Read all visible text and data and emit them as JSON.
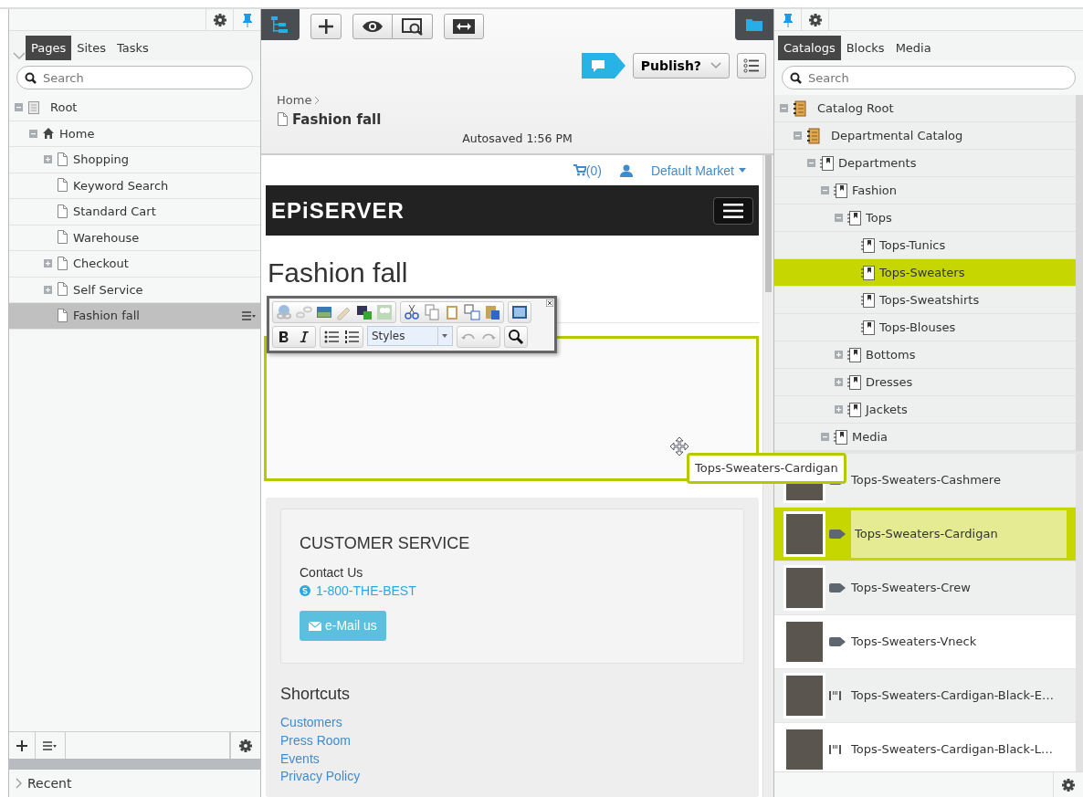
{
  "left_panel": {
    "tabs": [
      {
        "label": "Pages",
        "selected": true
      },
      {
        "label": "Sites",
        "selected": false
      },
      {
        "label": "Tasks",
        "selected": false
      }
    ],
    "search": {
      "placeholder": "Search"
    },
    "tree": [
      {
        "label": "Root",
        "kind": "root",
        "expanded": true,
        "selected": false,
        "children": [
          {
            "label": "Home",
            "kind": "home",
            "expanded": true,
            "selected": false,
            "children": [
              {
                "label": "Shopping",
                "kind": "page",
                "expanded": false,
                "selected": false
              },
              {
                "label": "Keyword Search",
                "kind": "page",
                "selected": false
              },
              {
                "label": "Standard Cart",
                "kind": "page",
                "selected": false
              },
              {
                "label": "Warehouse",
                "kind": "page",
                "selected": false
              },
              {
                "label": "Checkout",
                "kind": "page",
                "expanded": false,
                "selected": false
              },
              {
                "label": "Self Service",
                "kind": "page",
                "expanded": false,
                "selected": false
              },
              {
                "label": "Fashion fall",
                "kind": "page",
                "selected": true
              }
            ]
          }
        ]
      }
    ],
    "recent": "Recent"
  },
  "editor": {
    "breadcrumb": "Home",
    "page_title": "Fashion fall",
    "autosaved": "Autosaved 1:56 PM",
    "publish_button": "Publish?",
    "preview": {
      "cart_count": "(0)",
      "market": "Default Market",
      "logo": "EPiSERVER",
      "heading": "Fashion fall",
      "styles_dropdown": "Styles",
      "drag_tooltip": "Tops-Sweaters-Cardigan",
      "customer_service": {
        "title": "CUSTOMER SERVICE",
        "contact": "Contact Us",
        "phone": "1-800-THE-BEST",
        "email_button": "e-Mail us"
      },
      "shortcuts": {
        "title": "Shortcuts",
        "links": [
          "Customers",
          "Press Room",
          "Events",
          "Privacy Policy"
        ]
      }
    }
  },
  "right_panel": {
    "tabs": [
      {
        "label": "Catalogs",
        "selected": true
      },
      {
        "label": "Blocks",
        "selected": false
      },
      {
        "label": "Media",
        "selected": false
      }
    ],
    "search": {
      "placeholder": "Search"
    },
    "tree": [
      {
        "label": "Catalog Root",
        "kind": "catalog",
        "expanded": true,
        "selected": false,
        "children": [
          {
            "label": "Departmental Catalog",
            "kind": "catalog",
            "expanded": true,
            "selected": false,
            "children": [
              {
                "label": "Departments",
                "kind": "node",
                "expanded": true,
                "selected": false,
                "children": [
                  {
                    "label": "Fashion",
                    "kind": "node",
                    "expanded": true,
                    "selected": false,
                    "children": [
                      {
                        "label": "Tops",
                        "kind": "node",
                        "expanded": true,
                        "selected": false,
                        "children": [
                          {
                            "label": "Tops-Tunics",
                            "kind": "node",
                            "selected": false
                          },
                          {
                            "label": "Tops-Sweaters",
                            "kind": "node",
                            "selected": true
                          },
                          {
                            "label": "Tops-Sweatshirts",
                            "kind": "node",
                            "selected": false
                          },
                          {
                            "label": "Tops-Blouses",
                            "kind": "node",
                            "selected": false
                          }
                        ]
                      },
                      {
                        "label": "Bottoms",
                        "kind": "node",
                        "expanded": false,
                        "selected": false
                      },
                      {
                        "label": "Dresses",
                        "kind": "node",
                        "expanded": false,
                        "selected": false
                      },
                      {
                        "label": "Jackets",
                        "kind": "node",
                        "expanded": false,
                        "selected": false
                      }
                    ]
                  },
                  {
                    "label": "Media",
                    "kind": "node",
                    "expanded": true,
                    "selected": false
                  }
                ]
              }
            ]
          }
        ]
      }
    ],
    "items": [
      {
        "label": "Tops-Sweaters-Cashmere",
        "kind": "product",
        "selected": false
      },
      {
        "label": "Tops-Sweaters-Cardigan",
        "kind": "product",
        "selected": true
      },
      {
        "label": "Tops-Sweaters-Crew",
        "kind": "product",
        "selected": false
      },
      {
        "label": "Tops-Sweaters-Vneck",
        "kind": "product",
        "selected": false
      },
      {
        "label": "Tops-Sweaters-Cardigan-Black-E…",
        "kind": "variant",
        "selected": false
      },
      {
        "label": "Tops-Sweaters-Cardigan-Black-L…",
        "kind": "variant",
        "selected": false
      }
    ]
  }
}
